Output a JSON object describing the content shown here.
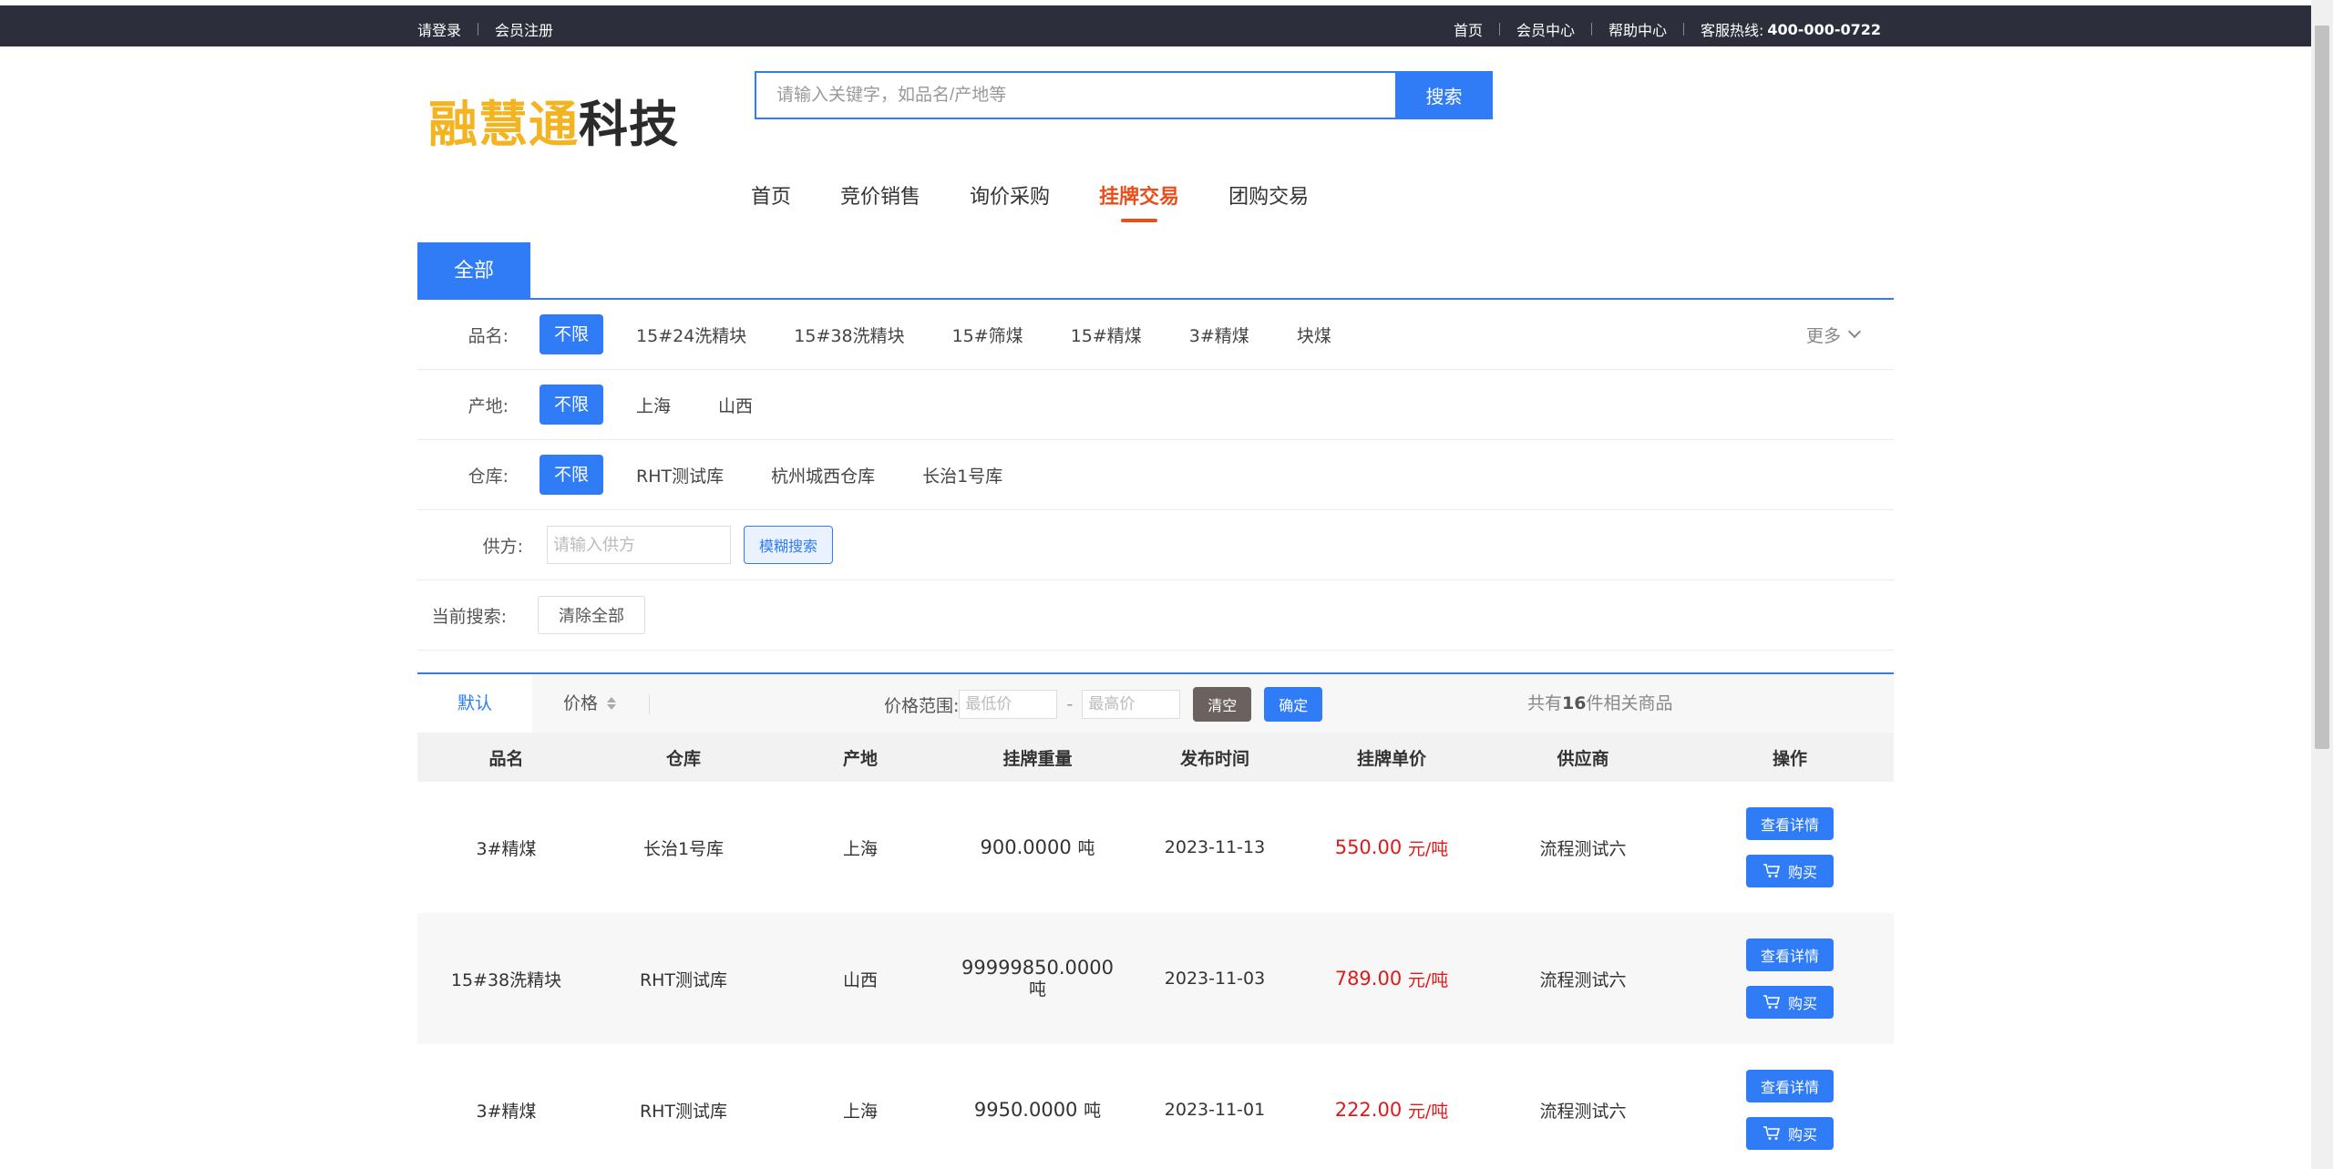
{
  "topbar": {
    "login": "请登录",
    "register": "会员注册",
    "home": "首页",
    "member_center": "会员中心",
    "help_center": "帮助中心",
    "hotline_label": "客服热线:",
    "hotline": "400-000-0722"
  },
  "logo": {
    "part1": "融慧通",
    "part2": "科技"
  },
  "search": {
    "placeholder": "请输入关键字，如品名/产地等",
    "button": "搜索"
  },
  "nav": [
    "首页",
    "竞价销售",
    "询价采购",
    "挂牌交易",
    "团购交易"
  ],
  "nav_active": "挂牌交易",
  "category_tab": "全部",
  "filters": {
    "name": {
      "label": "品名:",
      "options": [
        "不限",
        "15#24洗精块",
        "15#38洗精块",
        "15#筛煤",
        "15#精煤",
        "3#精煤",
        "块煤"
      ],
      "more": "更多"
    },
    "origin": {
      "label": "产地:",
      "options": [
        "不限",
        "上海",
        "山西"
      ]
    },
    "warehouse": {
      "label": "仓库:",
      "options": [
        "不限",
        "RHT测试库",
        "杭州城西仓库",
        "长治1号库"
      ]
    },
    "supplier": {
      "label": "供方:",
      "placeholder": "请输入供方",
      "button": "模糊搜索"
    },
    "current": {
      "label": "当前搜索:",
      "clear_all": "清除全部"
    }
  },
  "sortbar": {
    "default": "默认",
    "price": "价格",
    "range_label": "价格范围:",
    "min_placeholder": "最低价",
    "max_placeholder": "最高价",
    "dash": "-",
    "clear": "清空",
    "confirm": "确定",
    "total_prefix": "共有",
    "total_count": "16",
    "total_suffix": "件相关商品"
  },
  "table": {
    "headers": [
      "品名",
      "仓库",
      "产地",
      "挂牌重量",
      "发布时间",
      "挂牌单价",
      "供应商",
      "操作"
    ],
    "rows": [
      {
        "name": "3#精煤",
        "warehouse": "长治1号库",
        "origin": "上海",
        "weight": "900.0000",
        "weight_unit": "吨",
        "date": "2023-11-13",
        "price": "550.00",
        "price_unit": "元/吨",
        "supplier": "流程测试六"
      },
      {
        "name": "15#38洗精块",
        "warehouse": "RHT测试库",
        "origin": "山西",
        "weight": "99999850.0000",
        "weight_unit": "吨",
        "date": "2023-11-03",
        "price": "789.00",
        "price_unit": "元/吨",
        "supplier": "流程测试六"
      },
      {
        "name": "3#精煤",
        "warehouse": "RHT测试库",
        "origin": "上海",
        "weight": "9950.0000",
        "weight_unit": "吨",
        "date": "2023-11-01",
        "price": "222.00",
        "price_unit": "元/吨",
        "supplier": "流程测试六"
      }
    ],
    "detail_button": "查看详情",
    "buy_button": "购买"
  },
  "colors": {
    "primary": "#2f7cf6",
    "accent": "#e94f1d",
    "price": "#e01a1a",
    "topbar_bg": "#2c2f3b",
    "logo_gold": "#f4b321"
  }
}
